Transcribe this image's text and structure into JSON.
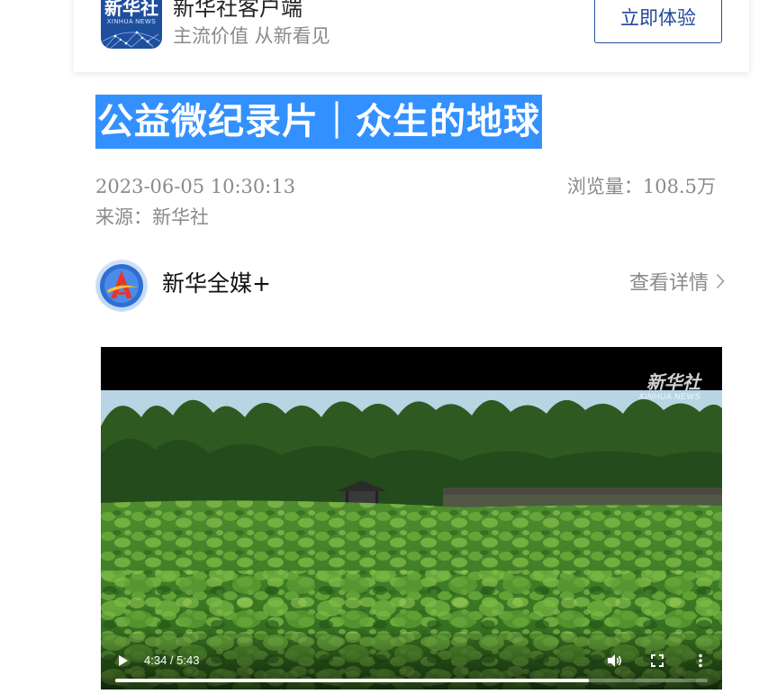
{
  "banner": {
    "logo_text": "新华社",
    "logo_sub": "XINHUA NEWS",
    "app_name": "新华社客户端",
    "slogan": "主流价值 从新看见",
    "try_button": "立即体验",
    "logo_color": "#1e4f9c"
  },
  "article": {
    "title": "公益微纪录片｜众生的地球",
    "publish_time": "2023-06-05 10:30:13",
    "views_label": "浏览量：",
    "views_value": "108.5万",
    "source": "来源：新华社",
    "title_highlight_color": "#3390ff"
  },
  "publisher": {
    "name": "新华全媒+",
    "detail_link": "查看详情",
    "avatar_icon": "xinhua-quanmei-logo-icon"
  },
  "video": {
    "watermark_main": "新华社",
    "watermark_sub": "XINHUA NEWS",
    "current_time": "4:34",
    "duration": "5:43",
    "time_display": "4:34 / 5:43",
    "progress": 0.7988
  }
}
